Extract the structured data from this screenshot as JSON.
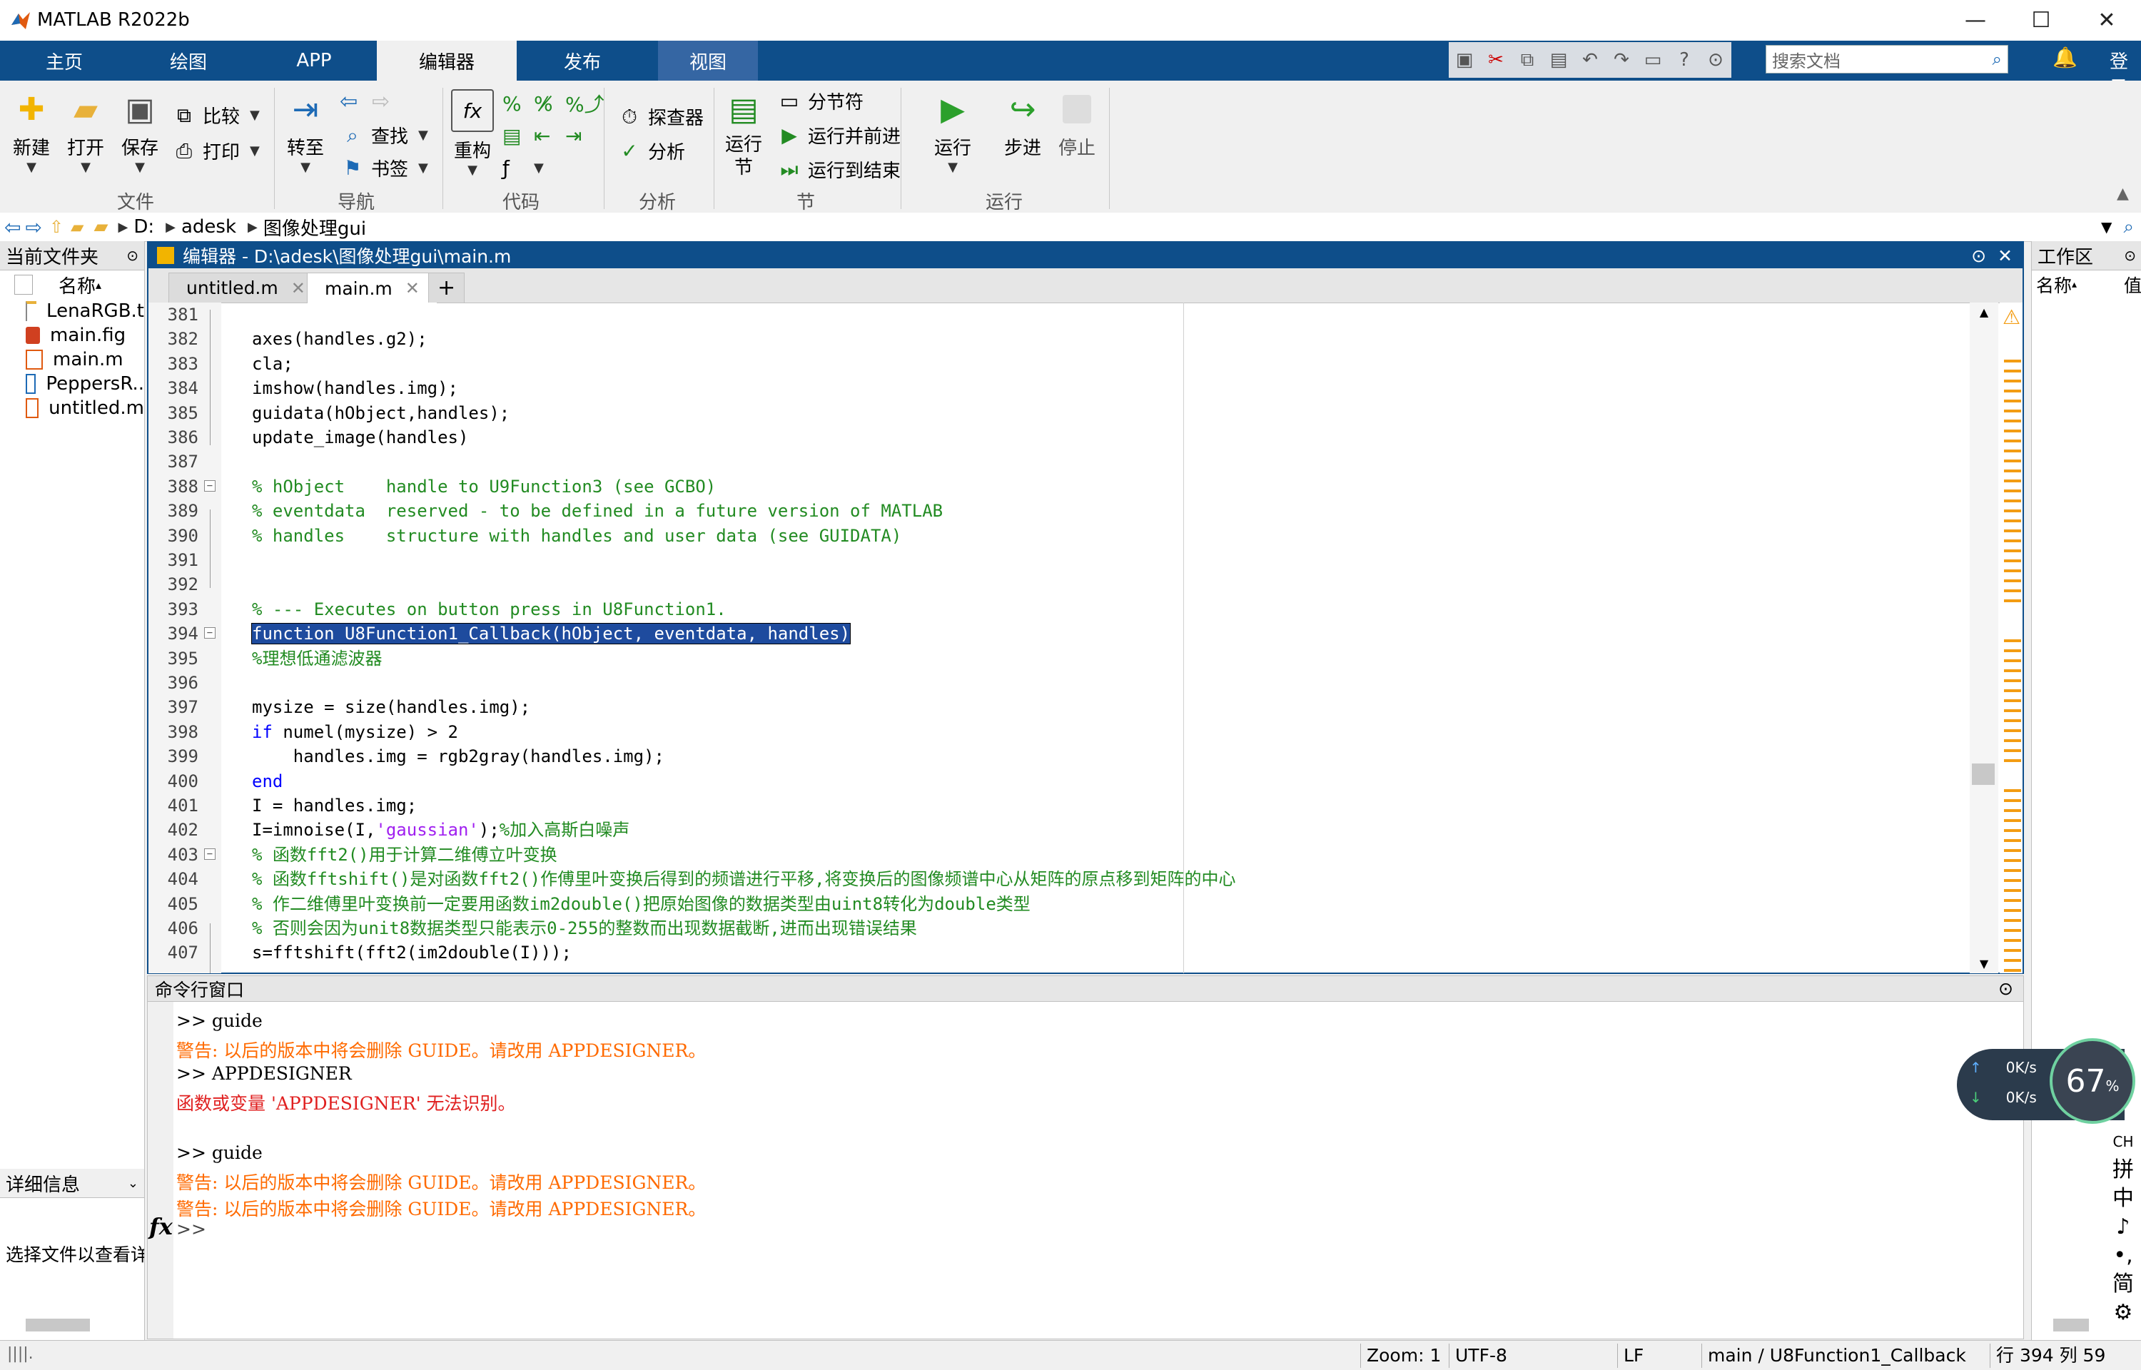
{
  "window": {
    "title": "MATLAB R2022b"
  },
  "ribbon_tabs": [
    "主页",
    "绘图",
    "APP",
    "编辑器",
    "发布",
    "视图"
  ],
  "search": {
    "placeholder": "搜索文档"
  },
  "login_label": "登录",
  "ribbon": {
    "file": {
      "new": "新建",
      "open": "打开",
      "save": "保存",
      "compare": "比较",
      "print": "打印",
      "group": "文件"
    },
    "nav": {
      "goto": "转至",
      "find": "查找",
      "bookmark": "书签",
      "group": "导航"
    },
    "code": {
      "refactor": "重构",
      "group": "代码"
    },
    "analyze": {
      "profiler": "探查器",
      "analyze": "分析",
      "group": "分析"
    },
    "section": {
      "run_section": "运行\n节",
      "section_break": "分节符",
      "run_advance": "运行并前进",
      "run_to_end": "运行到结束",
      "group": "节"
    },
    "run": {
      "run": "运行",
      "step": "步进",
      "stop": "停止",
      "group": "运行"
    }
  },
  "address": {
    "crumbs": [
      "D:",
      "adesk",
      "图像处理gui"
    ]
  },
  "current_folder": {
    "title": "当前文件夹",
    "col_name": "名称",
    "files": [
      "LenaRGB.t",
      "main.fig",
      "main.m",
      "PeppersR..",
      "untitled.m"
    ],
    "details_title": "详细信息",
    "details_text": "选择文件以查看详"
  },
  "editor": {
    "title": "编辑器 - D:\\adesk\\图像处理gui\\main.m",
    "tabs": [
      {
        "label": "untitled.m",
        "active": false
      },
      {
        "label": "main.m",
        "active": true
      }
    ],
    "add_tab": "+",
    "lines": [
      {
        "n": "381",
        "segs": [
          {
            "t": "",
            "c": ""
          }
        ]
      },
      {
        "n": "382",
        "segs": [
          {
            "t": "axes(handles.g2);",
            "c": ""
          }
        ]
      },
      {
        "n": "383",
        "segs": [
          {
            "t": "cla;",
            "c": ""
          }
        ]
      },
      {
        "n": "384",
        "segs": [
          {
            "t": "imshow(handles.img);",
            "c": ""
          }
        ]
      },
      {
        "n": "385",
        "segs": [
          {
            "t": "guidata(hObject,handles);",
            "c": ""
          }
        ]
      },
      {
        "n": "386",
        "segs": [
          {
            "t": "update_image(handles)",
            "c": ""
          }
        ]
      },
      {
        "n": "387",
        "segs": [
          {
            "t": "",
            "c": ""
          }
        ]
      },
      {
        "n": "388",
        "fold": true,
        "segs": [
          {
            "t": "% hObject    handle to U9Function3 (see GCBO)",
            "c": "cm"
          }
        ]
      },
      {
        "n": "389",
        "segs": [
          {
            "t": "% eventdata  reserved - to be defined in a future version of MATLAB",
            "c": "cm"
          }
        ]
      },
      {
        "n": "390",
        "segs": [
          {
            "t": "% handles    structure with handles and user data (see GUIDATA)",
            "c": "cm"
          }
        ]
      },
      {
        "n": "391",
        "segs": [
          {
            "t": "",
            "c": ""
          }
        ]
      },
      {
        "n": "392",
        "segs": [
          {
            "t": "",
            "c": ""
          }
        ]
      },
      {
        "n": "393",
        "segs": [
          {
            "t": "% --- Executes on button press in U8Function1.",
            "c": "cm"
          }
        ]
      },
      {
        "n": "394",
        "fold": true,
        "segs": [
          {
            "t": "function U8Function1_Callback(hObject, eventdata, handles)",
            "c": "sel"
          }
        ]
      },
      {
        "n": "395",
        "segs": [
          {
            "t": "%理想低通滤波器",
            "c": "cm"
          }
        ]
      },
      {
        "n": "396",
        "segs": [
          {
            "t": "",
            "c": ""
          }
        ]
      },
      {
        "n": "397",
        "segs": [
          {
            "t": "mysize = size(handles.img);",
            "c": ""
          }
        ]
      },
      {
        "n": "398",
        "segs": [
          {
            "t": "if",
            "c": "kw"
          },
          {
            "t": " numel(mysize) > 2",
            "c": ""
          }
        ]
      },
      {
        "n": "399",
        "segs": [
          {
            "t": "    handles.img = rgb2gray(handles.img);",
            "c": ""
          }
        ]
      },
      {
        "n": "400",
        "segs": [
          {
            "t": "end",
            "c": "kw"
          }
        ]
      },
      {
        "n": "401",
        "segs": [
          {
            "t": "I = handles.img;",
            "c": ""
          }
        ]
      },
      {
        "n": "402",
        "segs": [
          {
            "t": "I=imnoise(I,",
            "c": ""
          },
          {
            "t": "'gaussian'",
            "c": "st"
          },
          {
            "t": ");",
            "c": ""
          },
          {
            "t": "%加入高斯白噪声",
            "c": "cm"
          }
        ]
      },
      {
        "n": "403",
        "fold": true,
        "segs": [
          {
            "t": "% 函数fft2()用于计算二维傅立叶变换",
            "c": "cm"
          }
        ]
      },
      {
        "n": "404",
        "segs": [
          {
            "t": "% 函数fftshift()是对函数fft2()作傅里叶变换后得到的频谱进行平移,将变换后的图像频谱中心从矩阵的原点移到矩阵的中心",
            "c": "cm"
          }
        ]
      },
      {
        "n": "405",
        "segs": [
          {
            "t": "% 作二维傅里叶变换前一定要用函数im2double()把原始图像的数据类型由uint8转化为double类型",
            "c": "cm"
          }
        ]
      },
      {
        "n": "406",
        "segs": [
          {
            "t": "% 否则会因为unit8数据类型只能表示0-255的整数而出现数据截断,进而出现错误结果",
            "c": "cm"
          }
        ]
      },
      {
        "n": "407",
        "segs": [
          {
            "t": "s=fftshift(fft2(im2double(I)));",
            "c": ""
          }
        ]
      }
    ]
  },
  "command_window": {
    "title": "命令行窗口",
    "lines": [
      {
        "t": ">> guide",
        "c": ""
      },
      {
        "t": "警告: 以后的版本中将会删除 GUIDE。请改用 APPDESIGNER。",
        "c": "warn"
      },
      {
        "t": ">> APPDESIGNER",
        "c": ""
      },
      {
        "t": "函数或变量 'APPDESIGNER' 无法识别。",
        "c": "err"
      },
      {
        "t": "",
        "c": ""
      },
      {
        "t": ">> guide",
        "c": ""
      },
      {
        "t": "警告: 以后的版本中将会删除 GUIDE。请改用 APPDESIGNER。",
        "c": "warn"
      },
      {
        "t": "警告: 以后的版本中将会删除 GUIDE。请改用 APPDESIGNER。",
        "c": "warn"
      }
    ],
    "prompt": ">>",
    "fx": "fx"
  },
  "workspace": {
    "title": "工作区",
    "col_name": "名称",
    "col_value": "值"
  },
  "status": {
    "zoom": "Zoom: 1",
    "encoding": "UTF-8",
    "eol": "LF",
    "function": "main / U8Function1_Callback",
    "pos": "行 394 列 59"
  },
  "netmon": {
    "up": "0K/s",
    "down": "0K/s",
    "gauge": "67",
    "gauge_unit": "%"
  },
  "ime": [
    "CH",
    "拼",
    "中",
    "♪",
    "•,",
    "简",
    "⚙"
  ],
  "colors": {
    "accent": "#0e4e8a",
    "comment": "#228b22",
    "keyword": "#0000ff",
    "string": "#a020f0",
    "warning": "#ff6a00",
    "error": "#e02020"
  }
}
